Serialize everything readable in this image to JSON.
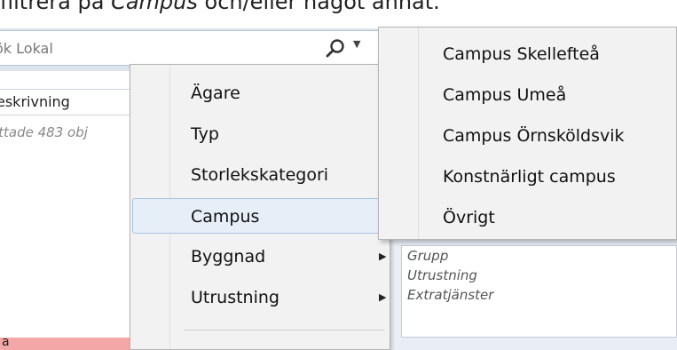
{
  "instruction": {
    "prefix": "filtrera på ",
    "emphasis": "Campus",
    "suffix": " och/eller något annat."
  },
  "search": {
    "value": "ök Lokal",
    "icon": "search-icon"
  },
  "table": {
    "column_header": "eskrivning",
    "hits_text": "ittade 483 obj",
    "pink_row_text": "a"
  },
  "context_menu": {
    "items": [
      {
        "label": "Ägare",
        "has_submenu": true
      },
      {
        "label": "Typ",
        "has_submenu": true
      },
      {
        "label": "Storlekskategori",
        "has_submenu": true
      },
      {
        "label": "Campus",
        "has_submenu": true,
        "highlighted": true
      },
      {
        "label": "Byggnad",
        "has_submenu": true
      },
      {
        "label": "Utrustning",
        "has_submenu": true
      }
    ],
    "arrow_glyph": "▶"
  },
  "campus_submenu": {
    "items": [
      {
        "label": "Campus Skellefteå"
      },
      {
        "label": "Campus Umeå"
      },
      {
        "label": "Campus Örnsköldsvik"
      },
      {
        "label": "Konstnärligt campus"
      },
      {
        "label": "Övrigt"
      }
    ]
  },
  "right_list": {
    "items": [
      {
        "label": "Grupp"
      },
      {
        "label": "Utrustning"
      },
      {
        "label": "Extratjänster"
      }
    ]
  },
  "colors": {
    "highlight_bg": "#e6eef8",
    "highlight_border": "#a9c3e3",
    "menu_bg": "#f2f2f2",
    "row_pink": "#f4a7a7"
  }
}
